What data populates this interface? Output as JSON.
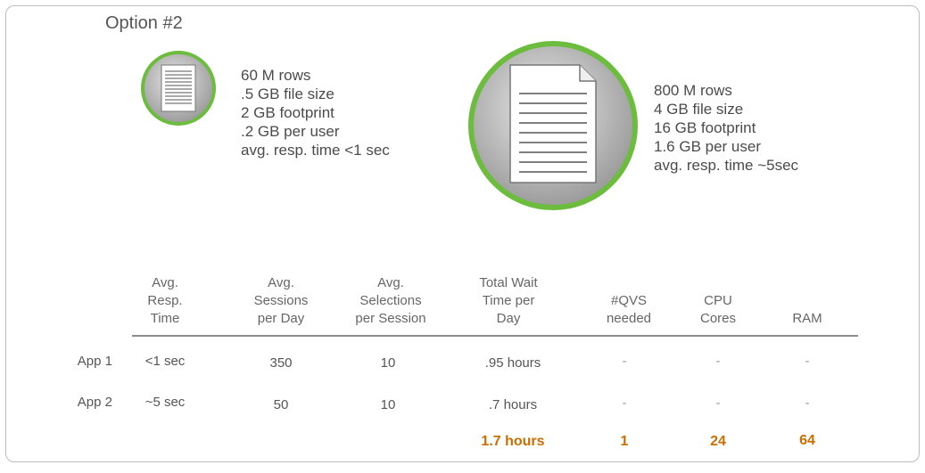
{
  "title": "Option #2",
  "small_file": {
    "icon": "document-icon",
    "ring_color": "#6cbc3e",
    "lines": [
      "60 M rows",
      ".5 GB file size",
      "2 GB footprint",
      ".2 GB per user",
      "avg. resp. time <1 sec"
    ]
  },
  "large_file": {
    "icon": "document-icon",
    "ring_color": "#6cbc3e",
    "lines": [
      "800 M rows",
      "4 GB file size",
      "16 GB footprint",
      "1.6 GB per user",
      "avg. resp. time ~5sec"
    ]
  },
  "table": {
    "headers": [
      [
        "Avg.",
        "Resp.",
        "Time"
      ],
      [
        "Avg.",
        "Sessions",
        "per Day"
      ],
      [
        "Avg.",
        "Selections",
        "per Session"
      ],
      [
        "Total Wait",
        "Time per",
        "Day"
      ],
      [
        "#QVS",
        "needed"
      ],
      [
        "CPU",
        "Cores"
      ],
      [
        "RAM"
      ]
    ],
    "rows": [
      {
        "label": "App 1",
        "cells": [
          "<1 sec",
          "350",
          "10",
          ".95 hours",
          "-",
          "-",
          "-"
        ]
      },
      {
        "label": "App 2",
        "cells": [
          "~5 sec",
          "50",
          "10",
          ".7 hours",
          "-",
          "-",
          "-"
        ]
      }
    ],
    "totals": [
      "1.7 hours",
      "1",
      "24",
      "64"
    ],
    "totals_color": "#cc6d00"
  }
}
